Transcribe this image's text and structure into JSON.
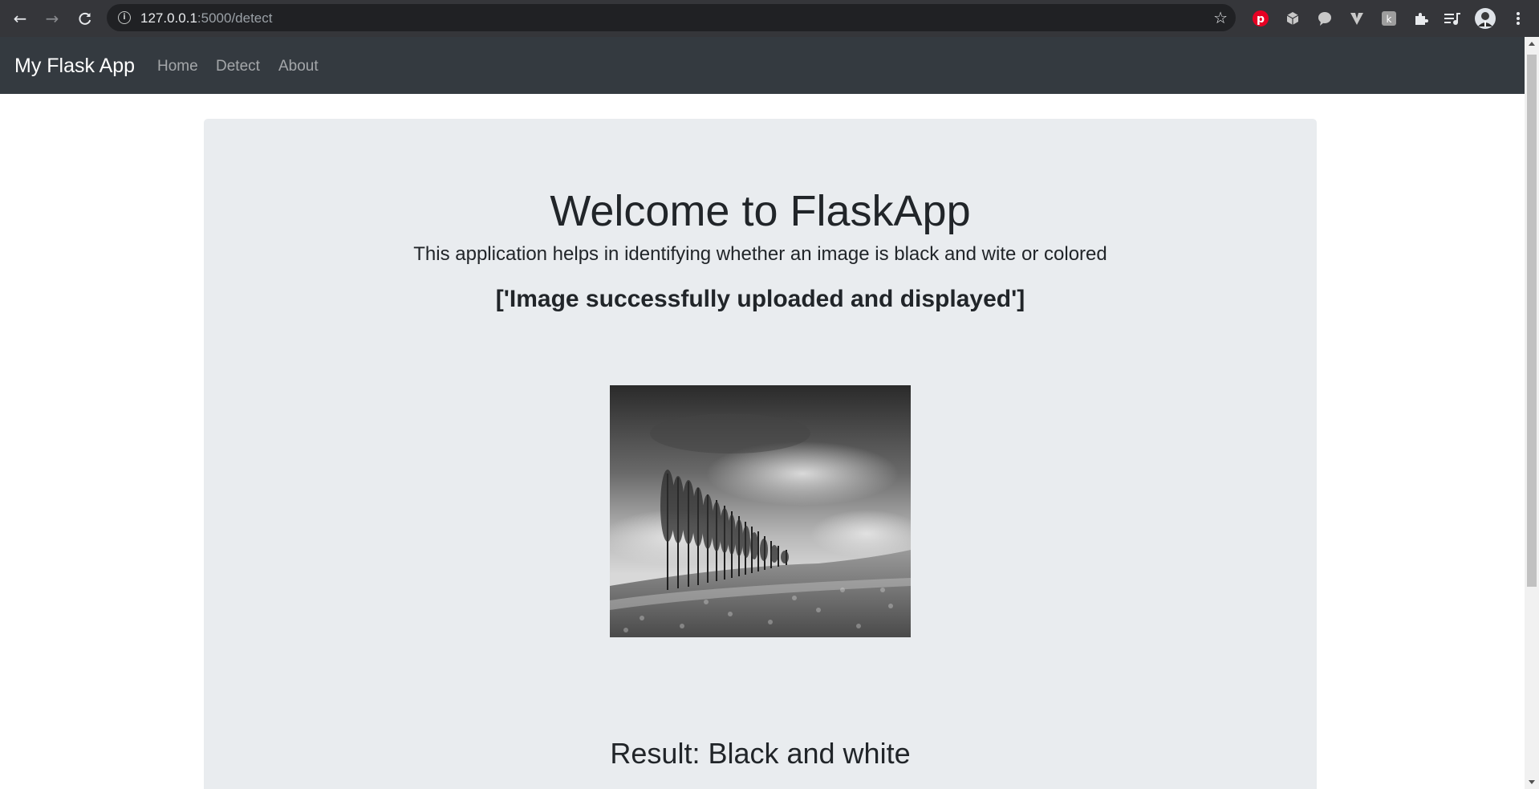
{
  "browser": {
    "url_host": "127.0.0.1",
    "url_path": ":5000/detect",
    "back_icon": "arrow-left-icon",
    "forward_icon": "arrow-right-icon",
    "reload_icon": "reload-icon",
    "info_icon": "info-icon",
    "bookmark_icon": "star-icon",
    "extensions": [
      "pinterest-icon",
      "cube-icon",
      "speech-bubble-icon",
      "v-icon",
      "k-icon",
      "puzzle-icon",
      "media-queue-icon",
      "avatar",
      "kebab-menu-icon"
    ]
  },
  "navbar": {
    "brand": "My Flask App",
    "links": [
      "Home",
      "Detect",
      "About"
    ]
  },
  "main": {
    "title": "Welcome to FlaskApp",
    "lead": "This application helps in identifying whether an image is black and wite or colored",
    "message": "['Image successfully uploaded and displayed']",
    "result": "Result: Black and white"
  }
}
